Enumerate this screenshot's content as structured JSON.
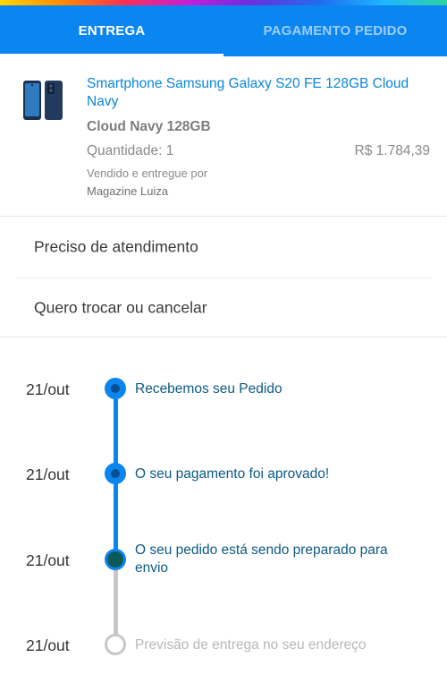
{
  "tabs": [
    {
      "label": "ENTREGA",
      "active": true
    },
    {
      "label": "PAGAMENTO PEDIDO",
      "active": false
    }
  ],
  "product": {
    "name": "Smartphone Samsung Galaxy S20 FE 128GB Cloud Navy",
    "variant": "Cloud Navy 128GB",
    "quantity": "Quantidade: 1",
    "price": "R$ 1.784,39",
    "sold_by_label": "Vendido e entregue por",
    "seller": "Magazine Luiza",
    "image_icon": "smartphone-image"
  },
  "menu": [
    {
      "label": "Preciso de atendimento"
    },
    {
      "label": "Quero trocar ou cancelar"
    }
  ],
  "timeline": [
    {
      "date": "21/out",
      "label": "Recebemos seu Pedido",
      "status": "done"
    },
    {
      "date": "21/out",
      "label": "O seu pagamento foi aprovado!",
      "status": "done"
    },
    {
      "date": "21/out",
      "label": "O seu pedido está sendo preparado para envio",
      "status": "current"
    },
    {
      "date": "21/out",
      "label": "Previsão de entrega no seu endereço",
      "status": "pending"
    }
  ],
  "colors": {
    "primary": "#0b86f1",
    "link": "#0a86d9",
    "timeline_text": "#0b5a86",
    "pending": "#c7c7c7"
  }
}
